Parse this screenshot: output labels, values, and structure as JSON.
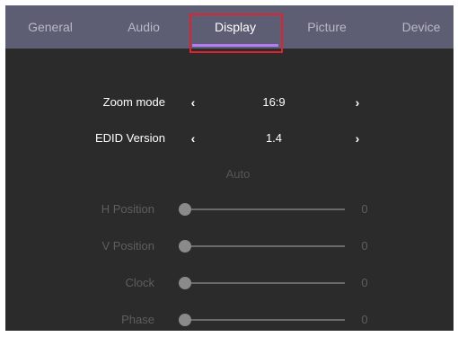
{
  "tabs": [
    {
      "label": "General",
      "active": false
    },
    {
      "label": "Audio",
      "active": false
    },
    {
      "label": "Display",
      "active": true
    },
    {
      "label": "Picture",
      "active": false
    },
    {
      "label": "Device",
      "active": false
    }
  ],
  "colors": {
    "tab_bar": "#5d5d73",
    "panel": "#2b2b2b",
    "active_indicator": "#b47cf2",
    "highlight_box": "#e0212e"
  },
  "settings": {
    "zoom_mode": {
      "label": "Zoom mode",
      "value": "16:9"
    },
    "edid_version": {
      "label": "EDID Version",
      "value": "1.4"
    }
  },
  "arrows": {
    "left": "‹",
    "right": "›"
  },
  "auto_button": "Auto",
  "sliders": [
    {
      "label": "H Position",
      "value": "0",
      "level": 0
    },
    {
      "label": "V Position",
      "value": "0",
      "level": 0
    },
    {
      "label": "Clock",
      "value": "0",
      "level": 0
    },
    {
      "label": "Phase",
      "value": "0",
      "level": 0
    }
  ]
}
